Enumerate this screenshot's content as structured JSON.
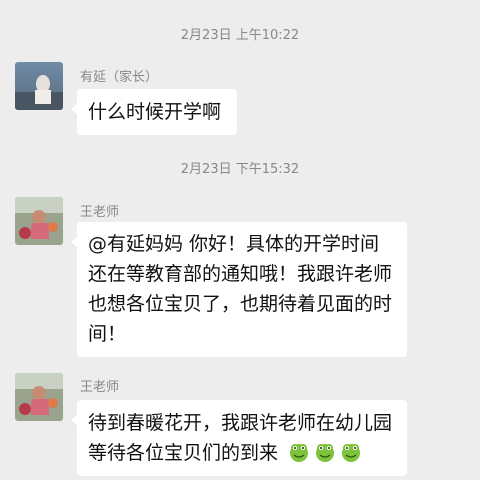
{
  "timestamps": [
    "2月23日 上午10:22",
    "2月23日 下午15:32"
  ],
  "messages": [
    {
      "sender": "有延（家长）",
      "text": "什么时候开学啊",
      "avatar": "parent-avatar"
    },
    {
      "sender": "王老师",
      "text": "@有延妈妈  你好！具体的开学时间还在等教育部的通知哦！我跟许老师也想各位宝贝了，也期待着见面的时间！",
      "avatar": "teacher-avatar"
    },
    {
      "sender": "王老师",
      "text": "待到春暖花开，我跟许老师在幼儿园等待各位宝贝们的到来",
      "avatar": "teacher-avatar",
      "emojis": [
        "frog-emoji",
        "frog-emoji",
        "frog-emoji"
      ]
    }
  ],
  "colors": {
    "background": "#ededed",
    "bubble": "#ffffff",
    "meta_text": "#888888"
  }
}
